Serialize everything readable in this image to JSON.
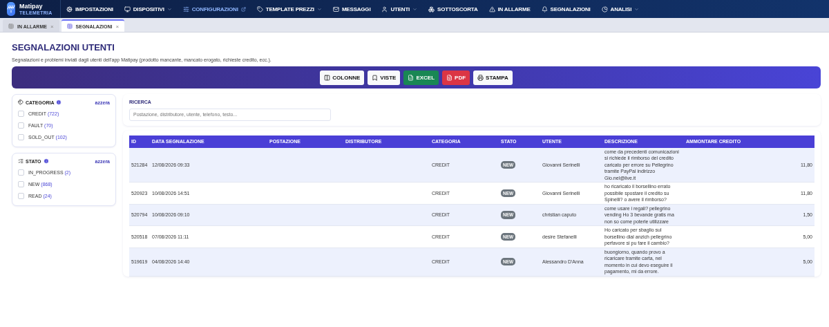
{
  "brand": {
    "name": "Matipay",
    "subtitle": "TELEMETRIA"
  },
  "nav": [
    {
      "label": "IMPOSTAZIONI",
      "dropdown": false,
      "external": false
    },
    {
      "label": "DISPOSITIVI",
      "dropdown": true,
      "external": false
    },
    {
      "label": "CONFIGURAZIONI",
      "dropdown": false,
      "external": true
    },
    {
      "label": "TEMPLATE PREZZI",
      "dropdown": true,
      "external": false
    },
    {
      "label": "MESSAGGI",
      "dropdown": false,
      "external": false
    },
    {
      "label": "UTENTI",
      "dropdown": true,
      "external": false
    },
    {
      "label": "SOTTOSCORTA",
      "dropdown": false,
      "external": false
    },
    {
      "label": "IN ALLARME",
      "dropdown": false,
      "external": false
    },
    {
      "label": "SEGNALAZIONI",
      "dropdown": false,
      "external": false
    },
    {
      "label": "ANALISI",
      "dropdown": true,
      "external": false
    }
  ],
  "tabs": [
    {
      "label": "IN ALLARME",
      "close": "×",
      "selected": false
    },
    {
      "label": "SEGNALAZIONI",
      "close": "×",
      "selected": true
    }
  ],
  "page": {
    "title": "SEGNALAZIONI UTENTI",
    "subtitle": "Segnalazioni e problemi inviati dagli utenti dell'app Matipay (prodotto mancante, mancato erogato, richieste credito, ecc.)."
  },
  "toolbar": [
    {
      "label": "COLONNE",
      "kind": "plain"
    },
    {
      "label": "VISTE",
      "kind": "plain"
    },
    {
      "label": "EXCEL",
      "kind": "excel"
    },
    {
      "label": "PDF",
      "kind": "pdf"
    },
    {
      "label": "STAMPA",
      "kind": "plain"
    }
  ],
  "filters": [
    {
      "title": "CATEGORIA",
      "reset": "azzera",
      "options": [
        {
          "label": "CREDIT",
          "count": "(722)",
          "checked": false
        },
        {
          "label": "FAULT",
          "count": "(70)",
          "checked": false
        },
        {
          "label": "SOLD_OUT",
          "count": "(102)",
          "checked": false
        }
      ]
    },
    {
      "title": "STATO",
      "reset": "azzera",
      "options": [
        {
          "label": "IN_PROGRESS",
          "count": "(2)",
          "checked": false
        },
        {
          "label": "NEW",
          "count": "(868)",
          "checked": false
        },
        {
          "label": "READ",
          "count": "(24)",
          "checked": false
        }
      ]
    }
  ],
  "search": {
    "label": "RICERCA",
    "placeholder": "Postazione, distributore, utente, telefono, testo..."
  },
  "table": {
    "columns": [
      "ID",
      "DATA SEGNALAZIONE",
      "POSTAZIONE",
      "DISTRIBUTORE",
      "CATEGORIA",
      "STATO",
      "UTENTE",
      "DESCRIZIONE",
      "AMMONTARE CREDITO"
    ],
    "rows": [
      {
        "id": "521284",
        "date": "12/08/2026 09:33",
        "category": "CREDIT",
        "status": "NEW",
        "user": "Giovanni Serinelli",
        "description": "come da precedenti comunicazioni si richiede il rimborso del credito caricato per errore su Pellegrino tramite PayPal indirizzo Gio.nel@live.it",
        "amount": "11,80"
      },
      {
        "id": "520923",
        "date": "10/08/2026 14:51",
        "category": "CREDIT",
        "status": "NEW",
        "user": "Giovanni Serinelli",
        "description": "ho ricaricato il borsellino errato possibile spostare il credito su Spinelli? o avere il rimborso?",
        "amount": "11,80"
      },
      {
        "id": "520794",
        "date": "10/08/2026 09:10",
        "category": "CREDIT",
        "status": "NEW",
        "user": "christian caputo",
        "description": "come usare i regali? pellegrino vending Ho 3 bevande gratis ma non so come poterle utilizzare",
        "amount": "1,50"
      },
      {
        "id": "520518",
        "date": "07/08/2026 11:11",
        "category": "CREDIT",
        "status": "NEW",
        "user": "desire Stefanelli",
        "description": "Ho caricato per sbaglio sul borsellino dial anzich pellegrino perfavore si pu fare il cambio?",
        "amount": "5,00"
      },
      {
        "id": "519619",
        "date": "04/08/2026 14:40",
        "category": "CREDIT",
        "status": "NEW",
        "user": "Alessandro D'Anna",
        "description": "buongiorno, quando provo a ricaricare tramite carta, nel momento in cui devo eseguire il pagamento, mi da errore.",
        "amount": "5,00"
      }
    ]
  }
}
